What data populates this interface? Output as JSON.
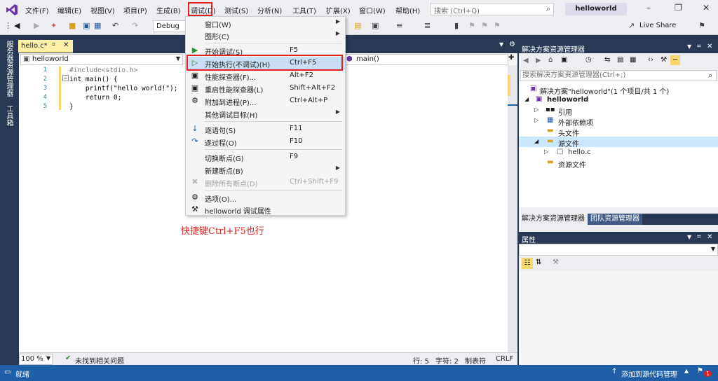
{
  "menubar": {
    "items": [
      "文件(F)",
      "编辑(E)",
      "视图(V)",
      "项目(P)",
      "生成(B)",
      "调试(D)",
      "测试(S)",
      "分析(N)",
      "工具(T)",
      "扩展(X)",
      "窗口(W)",
      "帮助(H)"
    ],
    "search_placeholder": "搜索 (Ctrl+Q)",
    "project_title": "helloworld"
  },
  "toolbar": {
    "config": "Debug",
    "live_share": "Live Share"
  },
  "left_strip": {
    "server_explorer": "服务器资源管理器",
    "toolbox": "工具箱"
  },
  "editor": {
    "tab_title": "hello.c*",
    "nav_project": "helloworld",
    "nav_member": "main()",
    "lines": [
      {
        "num": "1",
        "code": "#include<stdio.h>"
      },
      {
        "num": "2",
        "code": "int main() {"
      },
      {
        "num": "3",
        "code": "    printf(\"hello world!\");"
      },
      {
        "num": "4",
        "code": "    return 0;"
      },
      {
        "num": "5",
        "code": "}"
      }
    ],
    "zoom": "100 %",
    "issues": "未找到相关问题",
    "row": "行: 5",
    "col": "字符: 2",
    "tab_mode": "制表符",
    "eol": "CRLF"
  },
  "debug_menu": {
    "items": [
      {
        "label": "窗口(W)",
        "shortcut": "",
        "submenu": true,
        "disabled": false
      },
      {
        "label": "图形(C)",
        "shortcut": "",
        "submenu": true,
        "disabled": false
      },
      {
        "label": "开始调试(S)",
        "shortcut": "F5",
        "submenu": false,
        "disabled": false
      },
      {
        "label": "开始执行(不调试)(H)",
        "shortcut": "Ctrl+F5",
        "submenu": false,
        "disabled": false
      },
      {
        "label": "性能探查器(F)...",
        "shortcut": "Alt+F2",
        "submenu": false,
        "disabled": false
      },
      {
        "label": "重启性能探查器(L)",
        "shortcut": "Shift+Alt+F2",
        "submenu": false,
        "disabled": false
      },
      {
        "label": "附加到进程(P)...",
        "shortcut": "Ctrl+Alt+P",
        "submenu": false,
        "disabled": false
      },
      {
        "label": "其他调试目标(H)",
        "shortcut": "",
        "submenu": true,
        "disabled": false
      },
      {
        "label": "逐语句(S)",
        "shortcut": "F11",
        "submenu": false,
        "disabled": false
      },
      {
        "label": "逐过程(O)",
        "shortcut": "F10",
        "submenu": false,
        "disabled": false
      },
      {
        "label": "切换断点(G)",
        "shortcut": "F9",
        "submenu": false,
        "disabled": false
      },
      {
        "label": "新建断点(B)",
        "shortcut": "",
        "submenu": true,
        "disabled": false
      },
      {
        "label": "删除所有断点(D)",
        "shortcut": "Ctrl+Shift+F9",
        "submenu": false,
        "disabled": true
      },
      {
        "label": "选项(O)...",
        "shortcut": "",
        "submenu": false,
        "disabled": false
      },
      {
        "label": "helloworld 调试属性",
        "shortcut": "",
        "submenu": false,
        "disabled": false
      }
    ]
  },
  "annotation": "快捷键Ctrl+F5也行",
  "solution_explorer": {
    "title": "解决方案资源管理器",
    "search_placeholder": "搜索解决方案资源管理器(Ctrl+;)",
    "tree": [
      {
        "label": "解决方案\"helloworld\"(1 个项目/共 1 个)",
        "bold": false
      },
      {
        "label": "helloworld",
        "bold": true
      },
      {
        "label": "引用",
        "bold": false
      },
      {
        "label": "外部依赖项",
        "bold": false
      },
      {
        "label": "头文件",
        "bold": false
      },
      {
        "label": "源文件",
        "bold": false
      },
      {
        "label": "hello.c",
        "bold": false
      },
      {
        "label": "资源文件",
        "bold": false
      }
    ],
    "tab_solution": "解决方案资源管理器",
    "tab_team": "团队资源管理器"
  },
  "properties": {
    "title": "属性"
  },
  "statusbar": {
    "ready": "就绪",
    "source_control": "添加到源代码管理",
    "notif_count": "1"
  },
  "colors": {
    "accent": "#1e5fa8",
    "highlight_box": "#e0201c"
  }
}
